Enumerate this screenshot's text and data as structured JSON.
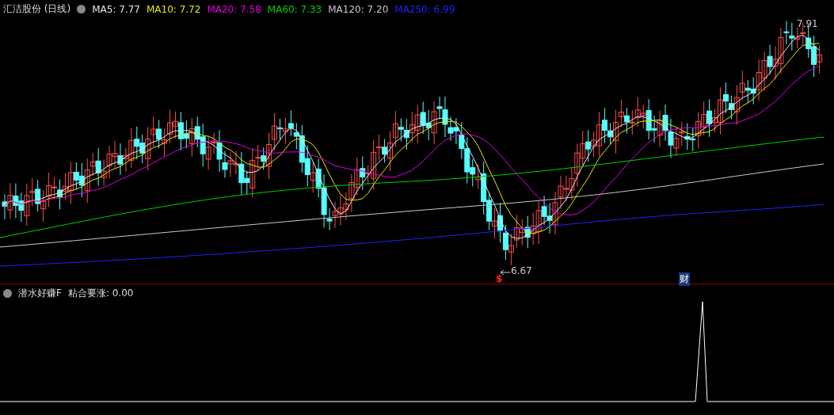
{
  "header": {
    "title": "汇洁股份 (日线)",
    "indicators": [
      {
        "label": "MA5: 7.77",
        "color": "#e6e6e6"
      },
      {
        "label": "MA10: 7.72",
        "color": "#e8e800"
      },
      {
        "label": "MA20: 7.58",
        "color": "#e000e0"
      },
      {
        "label": "MA60: 7.33",
        "color": "#00d000"
      },
      {
        "label": "MA120: 7.20",
        "color": "#c8c8c8"
      },
      {
        "label": "MA250: 6.99",
        "color": "#2020ff"
      }
    ]
  },
  "price_chart": {
    "high_label": "7.91",
    "low_label": "6.67",
    "markers": [
      {
        "kind": "signal",
        "text": "$"
      },
      {
        "kind": "finance",
        "text": "财"
      }
    ]
  },
  "sub_panel": {
    "title": "潜水好赚F",
    "reading": "粘合要涨: 0.00"
  }
}
